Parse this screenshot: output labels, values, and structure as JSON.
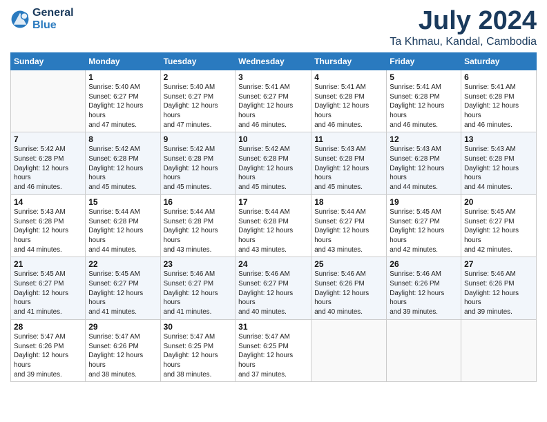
{
  "header": {
    "logo_line1": "General",
    "logo_line2": "Blue",
    "month": "July 2024",
    "location": "Ta Khmau, Kandal, Cambodia"
  },
  "weekdays": [
    "Sunday",
    "Monday",
    "Tuesday",
    "Wednesday",
    "Thursday",
    "Friday",
    "Saturday"
  ],
  "weeks": [
    [
      {
        "day": "",
        "sunrise": "",
        "sunset": "",
        "daylight": ""
      },
      {
        "day": "1",
        "sunrise": "Sunrise: 5:40 AM",
        "sunset": "Sunset: 6:27 PM",
        "daylight": "Daylight: 12 hours and 47 minutes."
      },
      {
        "day": "2",
        "sunrise": "Sunrise: 5:40 AM",
        "sunset": "Sunset: 6:27 PM",
        "daylight": "Daylight: 12 hours and 47 minutes."
      },
      {
        "day": "3",
        "sunrise": "Sunrise: 5:41 AM",
        "sunset": "Sunset: 6:27 PM",
        "daylight": "Daylight: 12 hours and 46 minutes."
      },
      {
        "day": "4",
        "sunrise": "Sunrise: 5:41 AM",
        "sunset": "Sunset: 6:28 PM",
        "daylight": "Daylight: 12 hours and 46 minutes."
      },
      {
        "day": "5",
        "sunrise": "Sunrise: 5:41 AM",
        "sunset": "Sunset: 6:28 PM",
        "daylight": "Daylight: 12 hours and 46 minutes."
      },
      {
        "day": "6",
        "sunrise": "Sunrise: 5:41 AM",
        "sunset": "Sunset: 6:28 PM",
        "daylight": "Daylight: 12 hours and 46 minutes."
      }
    ],
    [
      {
        "day": "7",
        "sunrise": "Sunrise: 5:42 AM",
        "sunset": "Sunset: 6:28 PM",
        "daylight": "Daylight: 12 hours and 46 minutes."
      },
      {
        "day": "8",
        "sunrise": "Sunrise: 5:42 AM",
        "sunset": "Sunset: 6:28 PM",
        "daylight": "Daylight: 12 hours and 45 minutes."
      },
      {
        "day": "9",
        "sunrise": "Sunrise: 5:42 AM",
        "sunset": "Sunset: 6:28 PM",
        "daylight": "Daylight: 12 hours and 45 minutes."
      },
      {
        "day": "10",
        "sunrise": "Sunrise: 5:42 AM",
        "sunset": "Sunset: 6:28 PM",
        "daylight": "Daylight: 12 hours and 45 minutes."
      },
      {
        "day": "11",
        "sunrise": "Sunrise: 5:43 AM",
        "sunset": "Sunset: 6:28 PM",
        "daylight": "Daylight: 12 hours and 45 minutes."
      },
      {
        "day": "12",
        "sunrise": "Sunrise: 5:43 AM",
        "sunset": "Sunset: 6:28 PM",
        "daylight": "Daylight: 12 hours and 44 minutes."
      },
      {
        "day": "13",
        "sunrise": "Sunrise: 5:43 AM",
        "sunset": "Sunset: 6:28 PM",
        "daylight": "Daylight: 12 hours and 44 minutes."
      }
    ],
    [
      {
        "day": "14",
        "sunrise": "Sunrise: 5:43 AM",
        "sunset": "Sunset: 6:28 PM",
        "daylight": "Daylight: 12 hours and 44 minutes."
      },
      {
        "day": "15",
        "sunrise": "Sunrise: 5:44 AM",
        "sunset": "Sunset: 6:28 PM",
        "daylight": "Daylight: 12 hours and 44 minutes."
      },
      {
        "day": "16",
        "sunrise": "Sunrise: 5:44 AM",
        "sunset": "Sunset: 6:28 PM",
        "daylight": "Daylight: 12 hours and 43 minutes."
      },
      {
        "day": "17",
        "sunrise": "Sunrise: 5:44 AM",
        "sunset": "Sunset: 6:28 PM",
        "daylight": "Daylight: 12 hours and 43 minutes."
      },
      {
        "day": "18",
        "sunrise": "Sunrise: 5:44 AM",
        "sunset": "Sunset: 6:27 PM",
        "daylight": "Daylight: 12 hours and 43 minutes."
      },
      {
        "day": "19",
        "sunrise": "Sunrise: 5:45 AM",
        "sunset": "Sunset: 6:27 PM",
        "daylight": "Daylight: 12 hours and 42 minutes."
      },
      {
        "day": "20",
        "sunrise": "Sunrise: 5:45 AM",
        "sunset": "Sunset: 6:27 PM",
        "daylight": "Daylight: 12 hours and 42 minutes."
      }
    ],
    [
      {
        "day": "21",
        "sunrise": "Sunrise: 5:45 AM",
        "sunset": "Sunset: 6:27 PM",
        "daylight": "Daylight: 12 hours and 41 minutes."
      },
      {
        "day": "22",
        "sunrise": "Sunrise: 5:45 AM",
        "sunset": "Sunset: 6:27 PM",
        "daylight": "Daylight: 12 hours and 41 minutes."
      },
      {
        "day": "23",
        "sunrise": "Sunrise: 5:46 AM",
        "sunset": "Sunset: 6:27 PM",
        "daylight": "Daylight: 12 hours and 41 minutes."
      },
      {
        "day": "24",
        "sunrise": "Sunrise: 5:46 AM",
        "sunset": "Sunset: 6:27 PM",
        "daylight": "Daylight: 12 hours and 40 minutes."
      },
      {
        "day": "25",
        "sunrise": "Sunrise: 5:46 AM",
        "sunset": "Sunset: 6:26 PM",
        "daylight": "Daylight: 12 hours and 40 minutes."
      },
      {
        "day": "26",
        "sunrise": "Sunrise: 5:46 AM",
        "sunset": "Sunset: 6:26 PM",
        "daylight": "Daylight: 12 hours and 39 minutes."
      },
      {
        "day": "27",
        "sunrise": "Sunrise: 5:46 AM",
        "sunset": "Sunset: 6:26 PM",
        "daylight": "Daylight: 12 hours and 39 minutes."
      }
    ],
    [
      {
        "day": "28",
        "sunrise": "Sunrise: 5:47 AM",
        "sunset": "Sunset: 6:26 PM",
        "daylight": "Daylight: 12 hours and 39 minutes."
      },
      {
        "day": "29",
        "sunrise": "Sunrise: 5:47 AM",
        "sunset": "Sunset: 6:26 PM",
        "daylight": "Daylight: 12 hours and 38 minutes."
      },
      {
        "day": "30",
        "sunrise": "Sunrise: 5:47 AM",
        "sunset": "Sunset: 6:25 PM",
        "daylight": "Daylight: 12 hours and 38 minutes."
      },
      {
        "day": "31",
        "sunrise": "Sunrise: 5:47 AM",
        "sunset": "Sunset: 6:25 PM",
        "daylight": "Daylight: 12 hours and 37 minutes."
      },
      {
        "day": "",
        "sunrise": "",
        "sunset": "",
        "daylight": ""
      },
      {
        "day": "",
        "sunrise": "",
        "sunset": "",
        "daylight": ""
      },
      {
        "day": "",
        "sunrise": "",
        "sunset": "",
        "daylight": ""
      }
    ]
  ]
}
